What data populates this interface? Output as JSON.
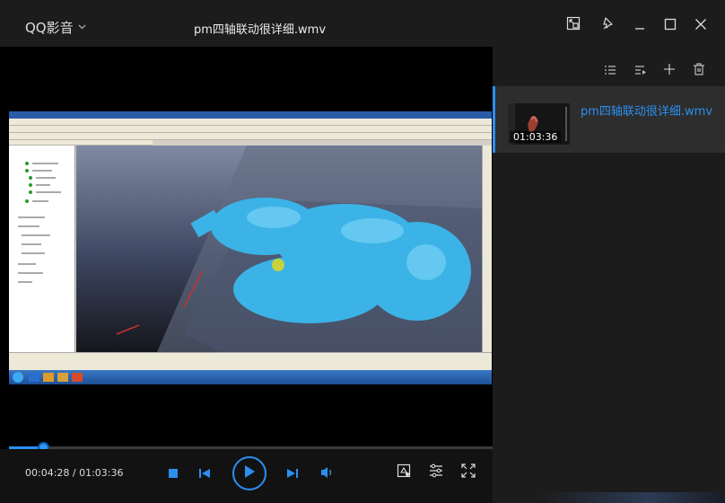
{
  "app": {
    "name": "QQ影音",
    "file_title": "pm四轴联动很详细.wmv"
  },
  "window_controls": {
    "icons": [
      "mini-mode-icon",
      "pin-icon",
      "minimize-icon",
      "maximize-icon",
      "close-icon"
    ]
  },
  "playback": {
    "current_time": "00:04:28",
    "total_time": "01:03:36",
    "time_display": "00:04:28 / 01:03:36",
    "progress": 0.0704,
    "accent_color": "#2b8ff0"
  },
  "controls": {
    "left_icons": [
      "stop-icon",
      "previous-icon",
      "play-icon",
      "next-icon",
      "volume-icon"
    ],
    "right_icons": [
      "screenshot-icon",
      "settings-icon",
      "fullscreen-icon"
    ]
  },
  "playlist": {
    "toolbar_icons": [
      "list-view-icon",
      "play-order-icon",
      "add-icon",
      "delete-icon"
    ],
    "items": [
      {
        "name": "pm四轴联动很详细.wmv",
        "duration": "01:03:36",
        "selected": true
      }
    ]
  }
}
